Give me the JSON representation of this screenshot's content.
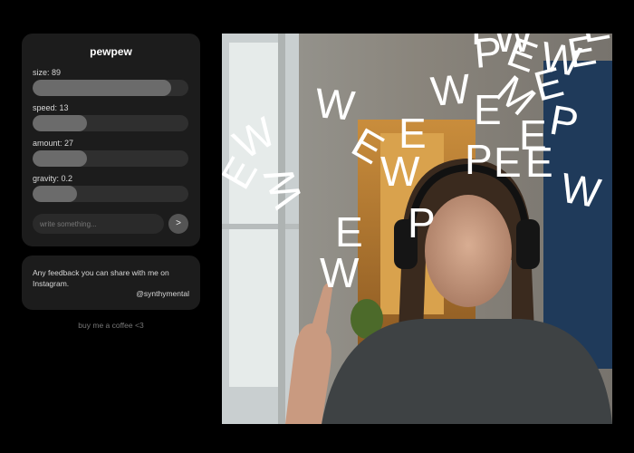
{
  "panel": {
    "title": "pewpew",
    "sliders": [
      {
        "label": "size: 89",
        "value": 89,
        "max": 100
      },
      {
        "label": "speed: 13",
        "value": 13,
        "max": 37
      },
      {
        "label": "amount: 27",
        "value": 27,
        "max": 78
      },
      {
        "label": "gravity: 0.2",
        "value": 0.2,
        "max": 0.7
      }
    ],
    "input_placeholder": "write something...",
    "send_label": ">"
  },
  "feedback": {
    "text": "Any feedback you can share with me on Instagram.",
    "handle": "@synthymental"
  },
  "coffee": {
    "label": "buy me a coffee <3"
  },
  "video": {
    "letters": [
      "P",
      "E",
      "W",
      "E",
      "W",
      "M",
      "E",
      "W",
      "E",
      "P",
      "E",
      "E",
      "W",
      "P",
      "E",
      "E",
      "W",
      "W",
      "P",
      "E",
      "W",
      "W",
      "E",
      "E",
      "W",
      "P",
      "E"
    ]
  }
}
